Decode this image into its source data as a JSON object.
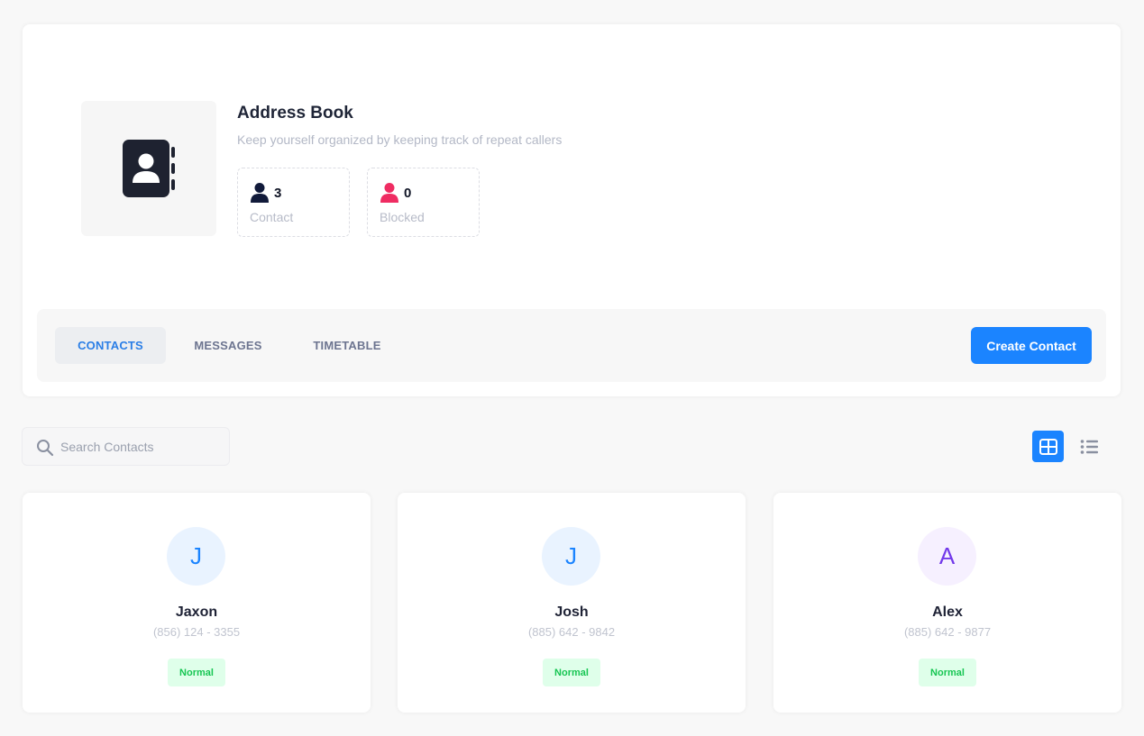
{
  "header": {
    "title": "Address Book",
    "subtitle": "Keep yourself organized by keeping track of repeat callers",
    "stats": [
      {
        "value": "3",
        "label": "Contact",
        "icon": "user-icon",
        "color": "#111a3a"
      },
      {
        "value": "0",
        "label": "Blocked",
        "icon": "user-blocked-icon",
        "color": "#ef2c62"
      }
    ]
  },
  "tabs": [
    {
      "label": "CONTACTS",
      "active": true
    },
    {
      "label": "MESSAGES",
      "active": false
    },
    {
      "label": "TIMETABLE",
      "active": false
    }
  ],
  "create_button": "Create Contact",
  "search": {
    "placeholder": "Search Contacts",
    "value": ""
  },
  "view_toggle": {
    "active": "grid",
    "options": [
      "grid-view-icon",
      "list-view-icon"
    ]
  },
  "contacts": [
    {
      "initial": "J",
      "name": "Jaxon",
      "phone": "(856) 124 - 3355",
      "status": "Normal",
      "avatar_bg": "#e9f3ff",
      "avatar_color": "#1b84ff"
    },
    {
      "initial": "J",
      "name": "Josh",
      "phone": "(885) 642 - 9842",
      "status": "Normal",
      "avatar_bg": "#e9f3ff",
      "avatar_color": "#1b84ff"
    },
    {
      "initial": "A",
      "name": "Alex",
      "phone": "(885) 642 - 9877",
      "status": "Normal",
      "avatar_bg": "#f6f0ff",
      "avatar_color": "#7239ea"
    }
  ],
  "colors": {
    "accent": "#1b84ff",
    "badge_bg": "#dfffea",
    "badge_text": "#17c653"
  }
}
